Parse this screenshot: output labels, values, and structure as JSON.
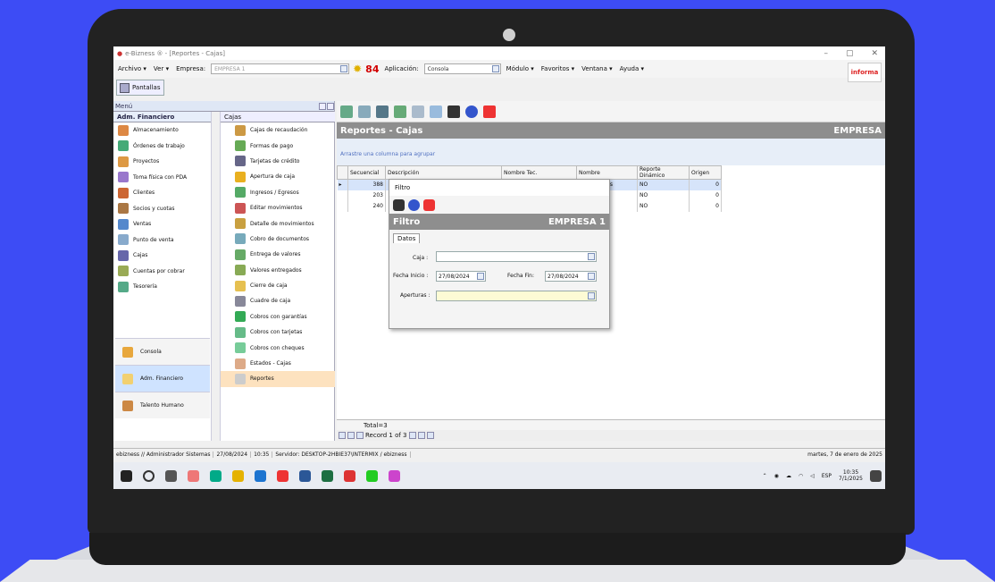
{
  "window": {
    "title": "e-Bizness ® - [Reportes - Cajas]",
    "min": "–",
    "max": "▢",
    "close": "✕"
  },
  "menubar": {
    "items": [
      "Archivo ▾",
      "Ver ▾",
      "Empresa:"
    ],
    "empresa_value": "EMPRESA 1",
    "counter": "84",
    "aplicacion_label": "Aplicación:",
    "aplicacion_value": "Consola",
    "right_items": [
      "Módulo ▾",
      "Favoritos ▾",
      "Ventana ▾",
      "Ayuda ▾"
    ],
    "logo_text": "informa"
  },
  "pantallas": {
    "label": "Pantallas"
  },
  "left_panel": {
    "menu_title": "Menú",
    "module_title": "Adm. Financiero",
    "modules": [
      "Almacenamiento",
      "Órdenes de trabajo",
      "Proyectos",
      "Toma física con PDA",
      "Clientes",
      "Socios y cuotas",
      "Ventas",
      "Punto de venta",
      "Cajas",
      "Cuentas por cobrar",
      "Tesorería"
    ],
    "big_buttons": [
      "Consola",
      "Adm. Financiero",
      "Talento Humano"
    ],
    "submenu_title": "Cajas",
    "submenu": [
      "Cajas de recaudación",
      "Formas de pago",
      "Tarjetas de crédito",
      "Apertura de caja",
      "Ingresos / Egresos",
      "Editar movimientos",
      "Detalle de movimientos",
      "Cobro de documentos",
      "Entrega de valores",
      "Valores entregados",
      "Cierre de caja",
      "Cuadre de caja",
      "Cobros con garantías",
      "Cobros con tarjetas",
      "Cobros con cheques",
      "Estados - Cajas",
      "Reportes"
    ]
  },
  "report": {
    "title": "Reportes - Cajas",
    "company": "EMPRESA",
    "group_hint": "Arrastre una columna para agrupar",
    "columns": [
      "Secuencial",
      "Descripción",
      "Nombre Tec.",
      "Nombre",
      "Reporte Dinámico",
      "Origen"
    ],
    "rows": [
      [
        "388",
        "",
        "",
        "...aturaCajas",
        "NO",
        "0"
      ],
      [
        "203",
        "",
        "",
        "...PagoCaja",
        "NO",
        "0"
      ],
      [
        "240",
        "",
        "",
        "...alCaja",
        "NO",
        "0"
      ]
    ],
    "total": "Total=3",
    "record": "Record 1 of 3"
  },
  "filter_dialog": {
    "window_title": "Filtro",
    "header": "Filtro",
    "company": "EMPRESA 1",
    "tab": "Datos",
    "caja_label": "Caja :",
    "fecha_inicio_label": "Fecha Inicio :",
    "fecha_inicio_value": "27/08/2024",
    "fecha_fin_label": "Fecha Fin:",
    "fecha_fin_value": "27/08/2024",
    "aperturas_label": "Aperturas :"
  },
  "statusbar": {
    "user": "ebizness // Administrador Sistemas",
    "date": "27/08/2024",
    "time": "10:35",
    "server": "Servidor: DESKTOP-2HBIE37\\INTERMIX / ebizness",
    "right_date": "martes, 7 de enero de 2025"
  },
  "taskbar": {
    "lang": "ESP",
    "clock_time": "10:35",
    "clock_date": "7/1/2025"
  }
}
